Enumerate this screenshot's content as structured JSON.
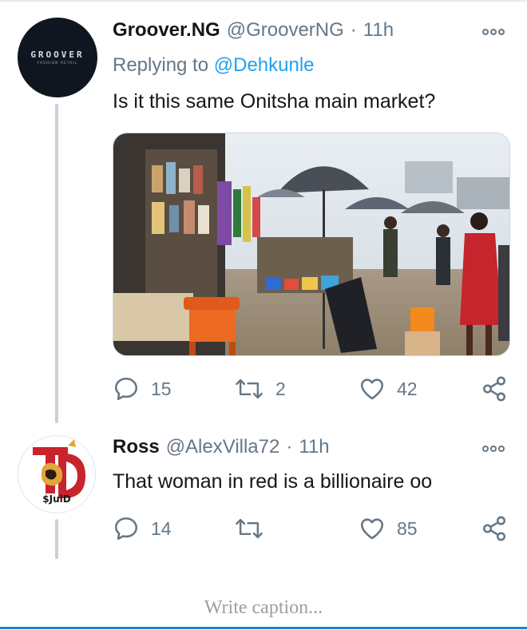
{
  "tweets": [
    {
      "avatar": {
        "brand": "GROOVER",
        "sub": "FASHION RETAIL"
      },
      "name": "Groover.NG",
      "handle": "@GrooverNG",
      "sep": "·",
      "time": "11h",
      "replying_prefix": "Replying to ",
      "replying_to": "@Dehkunle",
      "text": "Is it this same Onitsha main market?",
      "media_alt": "Photo of a market with stalls, umbrellas and a woman in red",
      "actions": {
        "replies": "15",
        "retweets": "2",
        "likes": "42"
      }
    },
    {
      "avatar": {
        "caption": "$JulD"
      },
      "name": "Ross",
      "handle": "@AlexVilla72",
      "sep": "·",
      "time": "11h",
      "text": "That woman in red is a billionaire oo",
      "actions": {
        "replies": "14",
        "retweets": "",
        "likes": "85"
      }
    }
  ],
  "caption_placeholder": "Write caption...",
  "colors": {
    "accent": "#1da1f2",
    "muted": "#657786",
    "caption_line": "#1b86c7"
  }
}
